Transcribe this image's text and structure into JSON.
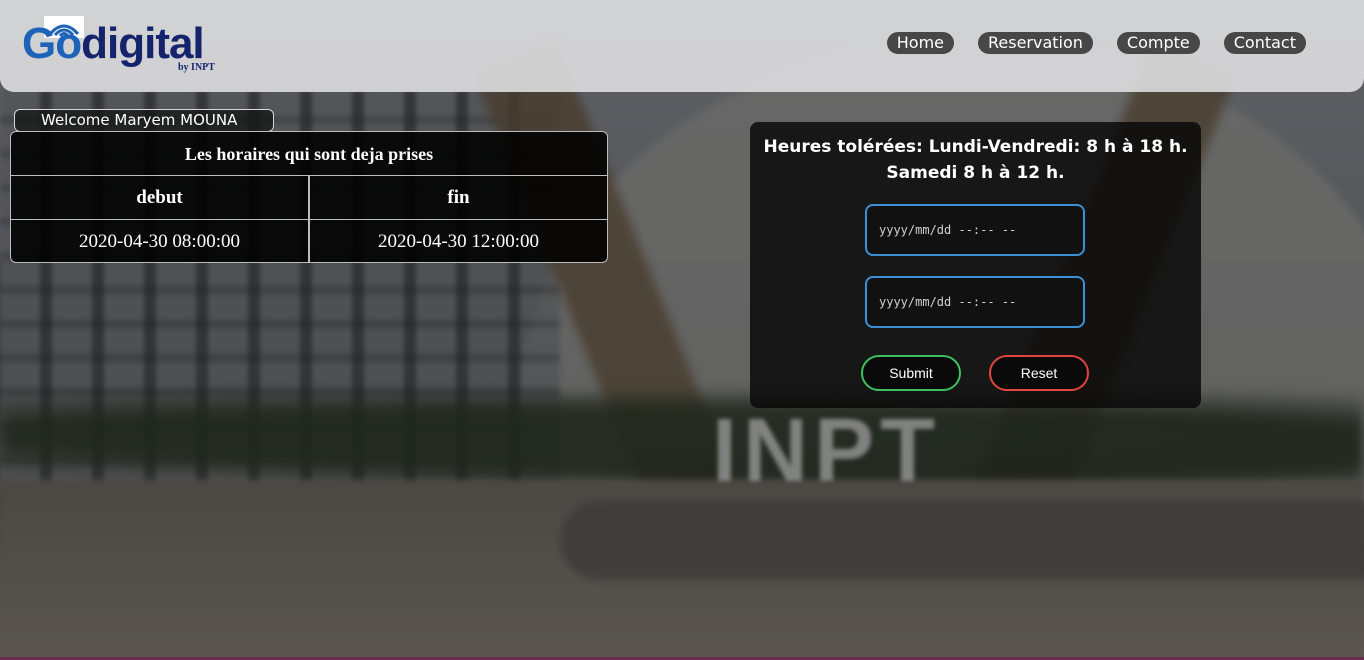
{
  "header": {
    "logo": {
      "text_go": "Go",
      "text_digital": "digital",
      "subtext": "by INPT"
    },
    "nav": [
      {
        "label": "Home"
      },
      {
        "label": "Reservation"
      },
      {
        "label": "Compte"
      },
      {
        "label": "Contact"
      }
    ]
  },
  "welcome": {
    "text": "Welcome Maryem MOUNA"
  },
  "schedule_table": {
    "caption": "Les horaires qui sont deja prises",
    "columns": [
      "debut",
      "fin"
    ],
    "rows": [
      [
        "2020-04-30 08:00:00",
        "2020-04-30 12:00:00"
      ]
    ]
  },
  "reservation_form": {
    "note_line1": "Heures tolérées: Lundi-Vendredi: 8 h à 18 h.",
    "note_line2": "Samedi 8 h à 12 h.",
    "start_placeholder": "yyyy/mm/dd --:-- --",
    "end_placeholder": "yyyy/mm/dd --:-- --",
    "submit_label": "Submit",
    "reset_label": "Reset"
  },
  "background": {
    "sign_text": "INPT"
  },
  "colors": {
    "brand_blue": "#1e63b8",
    "brand_navy": "#14236b",
    "input_border": "#3d8fd6",
    "submit_border": "#3bc15f",
    "reset_border": "#e0463f"
  }
}
